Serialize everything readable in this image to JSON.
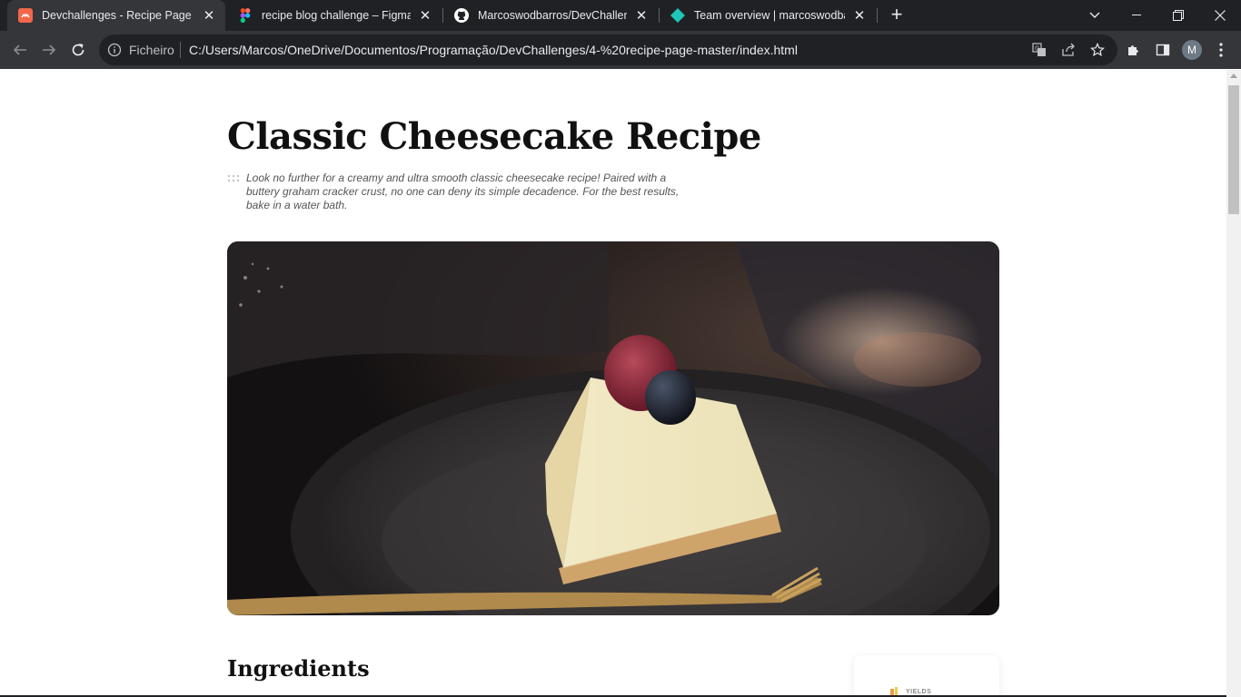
{
  "browser": {
    "tabs": [
      {
        "title": "Devchallenges - Recipe Page",
        "icon": "devchallenges-icon",
        "active": true
      },
      {
        "title": "recipe blog challenge – Figma",
        "icon": "figma-icon",
        "active": false
      },
      {
        "title": "Marcoswodbarros/DevChallenge",
        "icon": "github-icon",
        "active": false
      },
      {
        "title": "Team overview | marcoswodbarr",
        "icon": "netlify-icon",
        "active": false
      }
    ],
    "omnibox": {
      "scheme_label": "Ficheiro",
      "url": "C:/Users/Marcos/OneDrive/Documentos/Programação/DevChallenges/4-%20recipe-page-master/index.html"
    },
    "profile_initial": "M"
  },
  "page": {
    "title": "Classic Cheesecake Recipe",
    "intro": "Look no further for a creamy and ultra smooth classic cheesecake recipe! Paired with a buttery graham cracker crust, no one can deny its simple decadence. For the best results, bake in a water bath.",
    "section_heading": "Ingredients",
    "card": {
      "yields_label": "YIELDS"
    }
  },
  "colors": {
    "tab_strip": "#202124",
    "toolbar": "#35363a",
    "accent_orange": "#f2994a"
  }
}
